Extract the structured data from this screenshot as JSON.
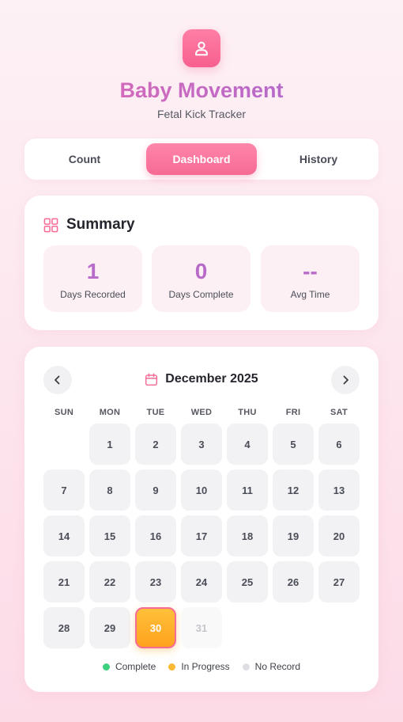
{
  "app": {
    "title": "Baby Movement",
    "subtitle": "Fetal Kick Tracker",
    "icon": "user-icon"
  },
  "tabs": [
    {
      "label": "Count",
      "active": false
    },
    {
      "label": "Dashboard",
      "active": true
    },
    {
      "label": "History",
      "active": false
    }
  ],
  "summary": {
    "title": "Summary",
    "icon": "grid-icon",
    "stats": [
      {
        "value": "1",
        "label": "Days Recorded"
      },
      {
        "value": "0",
        "label": "Days Complete"
      },
      {
        "value": "--",
        "label": "Avg Time"
      }
    ]
  },
  "calendar": {
    "month_label": "December 2025",
    "icon": "calendar-icon",
    "weekdays": [
      "SUN",
      "MON",
      "TUE",
      "WED",
      "THU",
      "FRI",
      "SAT"
    ],
    "first_weekday_index": 1,
    "days": [
      "1",
      "2",
      "3",
      "4",
      "5",
      "6",
      "7",
      "8",
      "9",
      "10",
      "11",
      "12",
      "13",
      "14",
      "15",
      "16",
      "17",
      "18",
      "19",
      "20",
      "21",
      "22",
      "23",
      "24",
      "25",
      "26",
      "27",
      "28",
      "29",
      "30",
      "31"
    ],
    "today": "30",
    "future_days": [
      "31"
    ]
  },
  "legend": [
    {
      "label": "Complete",
      "color": "#3dd17f"
    },
    {
      "label": "In Progress",
      "color": "#fbb935"
    },
    {
      "label": "No Record",
      "color": "#dedfe3"
    }
  ],
  "colors": {
    "accent": "#f66a94",
    "stat_value": "#b86ac9",
    "today": "#ffa21e"
  }
}
